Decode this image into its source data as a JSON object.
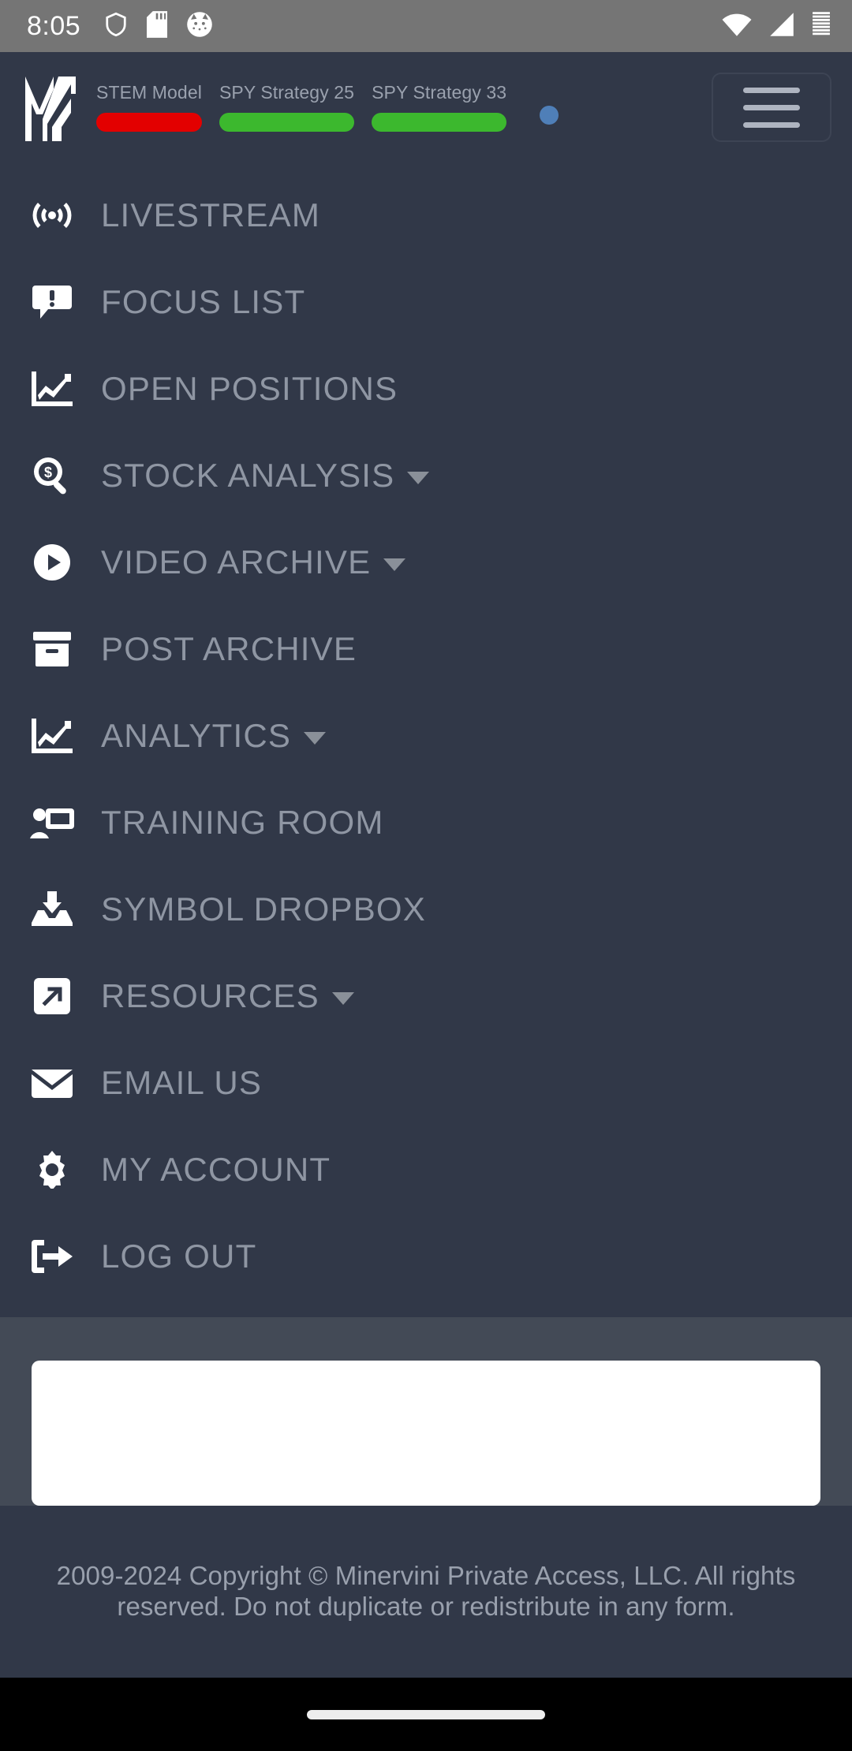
{
  "status_bar": {
    "clock": "8:05",
    "left_icons": [
      "shield-icon",
      "sd-card-icon",
      "cat-face-icon"
    ],
    "right_icons": [
      "wifi-icon",
      "cellular-signal-icon",
      "battery-icon"
    ]
  },
  "header": {
    "logo_name": "minervini-logo",
    "menu_button_label": "menu",
    "notification_dot_color": "#4f7fb8",
    "strategies": [
      {
        "label": "STEM Model",
        "status_color": "#e30000"
      },
      {
        "label": "SPY Strategy 25",
        "status_color": "#3cb82e"
      },
      {
        "label": "SPY Strategy 33",
        "status_color": "#3cb82e"
      }
    ]
  },
  "menu": {
    "items": [
      {
        "label": "LIVESTREAM",
        "icon": "broadcast-tower-icon",
        "has_dropdown": false
      },
      {
        "label": "FOCUS LIST",
        "icon": "comment-alert-icon",
        "has_dropdown": false
      },
      {
        "label": "OPEN POSITIONS",
        "icon": "chart-line-icon",
        "has_dropdown": false
      },
      {
        "label": "STOCK ANALYSIS",
        "icon": "search-dollar-icon",
        "has_dropdown": true
      },
      {
        "label": "VIDEO ARCHIVE",
        "icon": "play-circle-icon",
        "has_dropdown": true
      },
      {
        "label": "POST ARCHIVE",
        "icon": "archive-box-icon",
        "has_dropdown": false
      },
      {
        "label": "ANALYTICS",
        "icon": "chart-line-icon",
        "has_dropdown": true
      },
      {
        "label": "TRAINING ROOM",
        "icon": "person-chalkboard-icon",
        "has_dropdown": false
      },
      {
        "label": "SYMBOL DROPBOX",
        "icon": "inbox-download-icon",
        "has_dropdown": false
      },
      {
        "label": "RESOURCES",
        "icon": "external-link-icon",
        "has_dropdown": true
      },
      {
        "label": "EMAIL US",
        "icon": "envelope-icon",
        "has_dropdown": false
      },
      {
        "label": "MY ACCOUNT",
        "icon": "gear-icon",
        "has_dropdown": false
      },
      {
        "label": "LOG OUT",
        "icon": "sign-out-icon",
        "has_dropdown": false
      }
    ]
  },
  "content": {
    "placeholder_card": ""
  },
  "footer": {
    "copyright": "2009-2024 Copyright © Minervini Private Access, LLC. All rights reserved. Do not duplicate or redistribute in any form."
  },
  "theme": {
    "menu_bg": "#313848",
    "content_bg": "#434a56",
    "status_bar_bg": "#757575",
    "label_color": "#8f96a3",
    "nav_bar_bg": "#000000"
  }
}
